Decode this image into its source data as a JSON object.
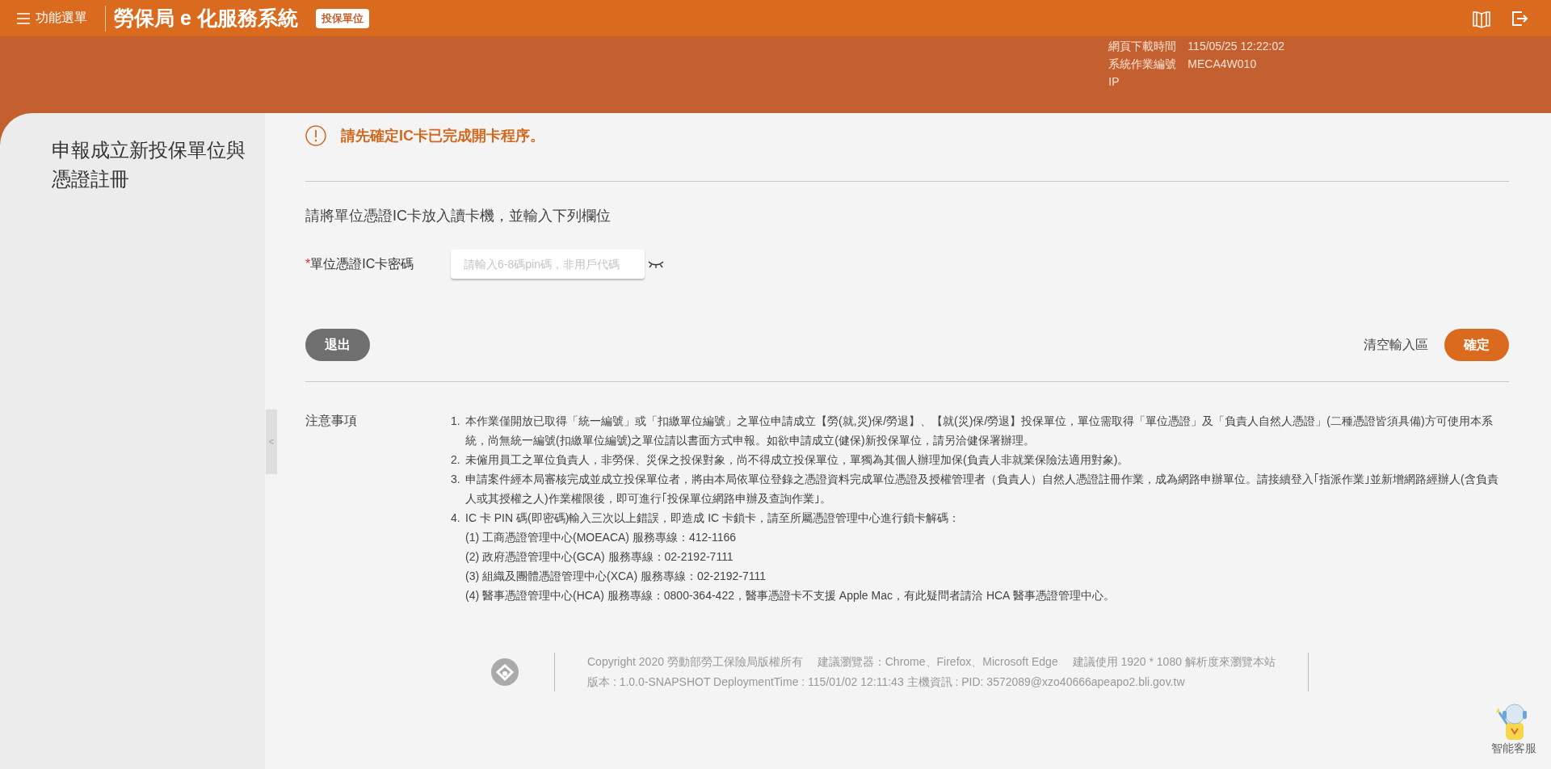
{
  "header": {
    "menu_label": "功能選單",
    "title": "勞保局 e 化服務系統",
    "badge": "投保單位"
  },
  "info": [
    {
      "label": "網頁下載時間",
      "value": "115/05/25 12:22:02"
    },
    {
      "label": "系統作業編號",
      "value": "MECA4W010"
    },
    {
      "label": "IP"
    }
  ],
  "sidebar": {
    "title": "申報成立新投保單位與憑證註冊",
    "collapse": "<"
  },
  "warning": "請先確定IC卡已完成開卡程序。",
  "instruction": "請將單位憑證IC卡放入讀卡機，並輸入下列欄位",
  "field": {
    "required_mark": "*",
    "label": "單位憑證IC卡密碼",
    "placeholder": "請輸入6-8碼pin碼，非用戶代碼"
  },
  "buttons": {
    "exit": "退出",
    "clear": "清空輸入區",
    "confirm": "確定"
  },
  "notes": {
    "title": "注意事項",
    "items": [
      {
        "number": "1.",
        "text": "本作業僅開放已取得「統一編號」或「扣繳單位編號」之單位申請成立【勞(就,災)保/勞退】、【就(災)保/勞退】投保單位，單位需取得「單位憑證」及「負責人自然人憑證」(二種憑證皆須具備)方可使用本系統，尚無統一編號(扣繳單位編號)之單位請以書面方式申報。如欲申請成立(健保)新投保單位，請另洽健保署辦理。"
      },
      {
        "number": "2.",
        "text": "未僱用員工之單位負責人，非勞保、災保之投保對象，尚不得成立投保單位，單獨為其個人辦理加保(負責人非就業保險法適用對象)。"
      },
      {
        "number": "3.",
        "text": "申請案件經本局審核完成並成立投保單位者，將由本局依單位登錄之憑證資料完成單位憑證及授權管理者（負責人）自然人憑證註冊作業，成為網路申辦單位。請接續登入｢指派作業｣並新增網路經辦人(含負責人或其授權之人)作業權限後，即可進行｢投保單位網路申辦及查詢作業｣。"
      },
      {
        "number": "4.",
        "text": "IC 卡 PIN 碼(即密碼)輸入三次以上錯誤，即造成 IC 卡鎖卡，請至所屬憑證管理中心進行鎖卡解碼：",
        "children": [
          {
            "text": "(1) 工商憑證管理中心(MOEACA) 服務專線：412-1166"
          },
          {
            "text": "(2) 政府憑證管理中心(GCA) 服務專線：02-2192-7111"
          },
          {
            "text": "(3) 組織及團體憑證管理中心(XCA) 服務專線：02-2192-7111"
          },
          {
            "text": "(4) 醫事憑證管理中心(HCA) 服務專線：0800-364-422，醫事憑證卡不支援 Apple Mac，有此疑問者請洽 HCA 醫事憑證管理中心。"
          }
        ]
      }
    ]
  },
  "footer": {
    "lines": [
      "Copyright 2020 勞動部勞工保險局版權所有　 建議瀏覽器：Chrome、Firefox、Microsoft Edge　 建議使用 1920 * 1080 解析度來瀏覽本站",
      "版本 : 1.0.0-SNAPSHOT DeploymentTime : 115/01/02 12:11:43 主機資訊 : PID: 3572089@xzo40666apeapo2.bli.gov.tw"
    ]
  },
  "assistant": {
    "label": "智能客服"
  }
}
